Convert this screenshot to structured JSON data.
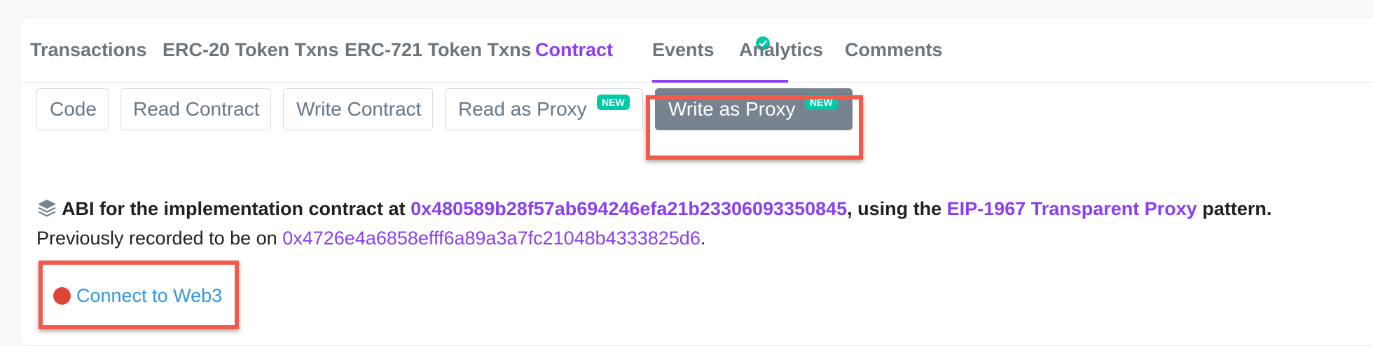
{
  "tabs": [
    {
      "label": "Transactions"
    },
    {
      "label": "ERC-20 Token Txns"
    },
    {
      "label": "ERC-721 Token Txns"
    },
    {
      "label": "Contract",
      "active": true
    },
    {
      "label": "Events"
    },
    {
      "label": "Analytics"
    },
    {
      "label": "Comments"
    }
  ],
  "subtabs": [
    {
      "label": "Code"
    },
    {
      "label": "Read Contract"
    },
    {
      "label": "Write Contract"
    },
    {
      "label": "Read as Proxy",
      "badge": "NEW"
    },
    {
      "label": "Write as Proxy",
      "badge": "NEW",
      "active": true
    }
  ],
  "abi": {
    "prefix": "ABI for the implementation contract at",
    "address": "0x480589b28f57ab694246efa21b23306093350845",
    "middle": ", using the",
    "pattern_link": "EIP-1967 Transparent Proxy",
    "suffix": "pattern."
  },
  "previous": {
    "prefix": "Previously recorded to be on",
    "address": "0x4726e4a6858efff6a89a3a7fc21048b4333825d6",
    "suffix": "."
  },
  "connect": {
    "label": "Connect to Web3",
    "status_color": "#de4437"
  },
  "colors": {
    "accent": "#8b3ff0",
    "badge": "#00c9a7",
    "highlight": "#f25a4b",
    "link": "#3498db"
  },
  "icons": {
    "verified": "check-circle-icon",
    "abi": "layer-group-icon",
    "connection_status": "red-dot-icon"
  }
}
